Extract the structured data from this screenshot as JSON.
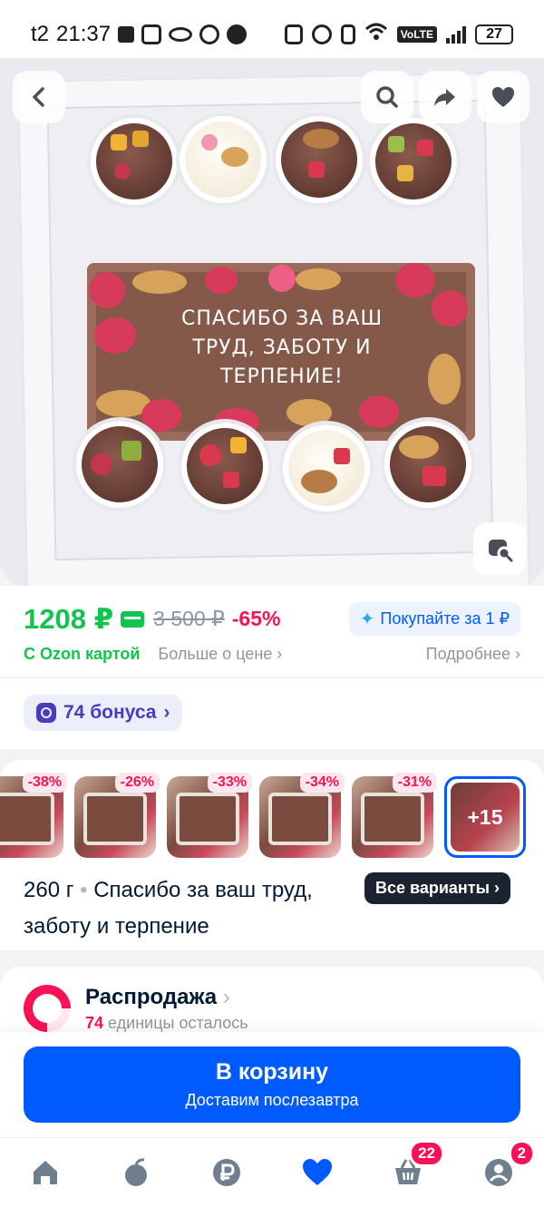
{
  "status_bar": {
    "carrier": "t2",
    "time": "21:37",
    "battery": "27",
    "network": "VoLTE"
  },
  "hero": {
    "plate_text_line1": "СПАСИБО ЗА ВАШ",
    "plate_text_line2": "ТРУД, ЗАБОТУ И",
    "plate_text_line3": "ТЕРПЕНИЕ!",
    "buttons": [
      "back-icon",
      "search-icon",
      "share-icon",
      "heart-icon",
      "image-search-icon"
    ]
  },
  "price": {
    "current": "1208 ₽",
    "old": "3 500 ₽",
    "discount": "-65%",
    "buy_for_1_label": "Покупайте за 1 ₽",
    "ozon_card_label": "С Ozon картой",
    "more_about_price": "Больше о цене",
    "details": "Подробнее",
    "accent_green": "#10c44c",
    "accent_red": "#f91155"
  },
  "bonus": {
    "label": "74 бонуса"
  },
  "variants": {
    "thumbnails": [
      {
        "badge": "-38%"
      },
      {
        "badge": "-26%"
      },
      {
        "badge": "-33%"
      },
      {
        "badge": "-34%"
      },
      {
        "badge": "-31%"
      }
    ],
    "more_count": "+15",
    "weight": "260 г",
    "separator": "•",
    "title": "Спасибо за ваш труд, заботу и терпение",
    "all_variants_label": "Все варианты"
  },
  "seller": {
    "name": "Распродажа",
    "count": "74",
    "remaining_text": "единицы осталось"
  },
  "cart": {
    "button_label": "В корзину",
    "delivery_text": "Доставим послезавтра",
    "accent_blue": "#005bff"
  },
  "tabbar": {
    "tabs": [
      "home-icon",
      "fresh-icon",
      "ruble-icon",
      "favorites-icon",
      "cart-icon",
      "profile-icon"
    ],
    "cart_count": "22",
    "profile_count": "2"
  }
}
